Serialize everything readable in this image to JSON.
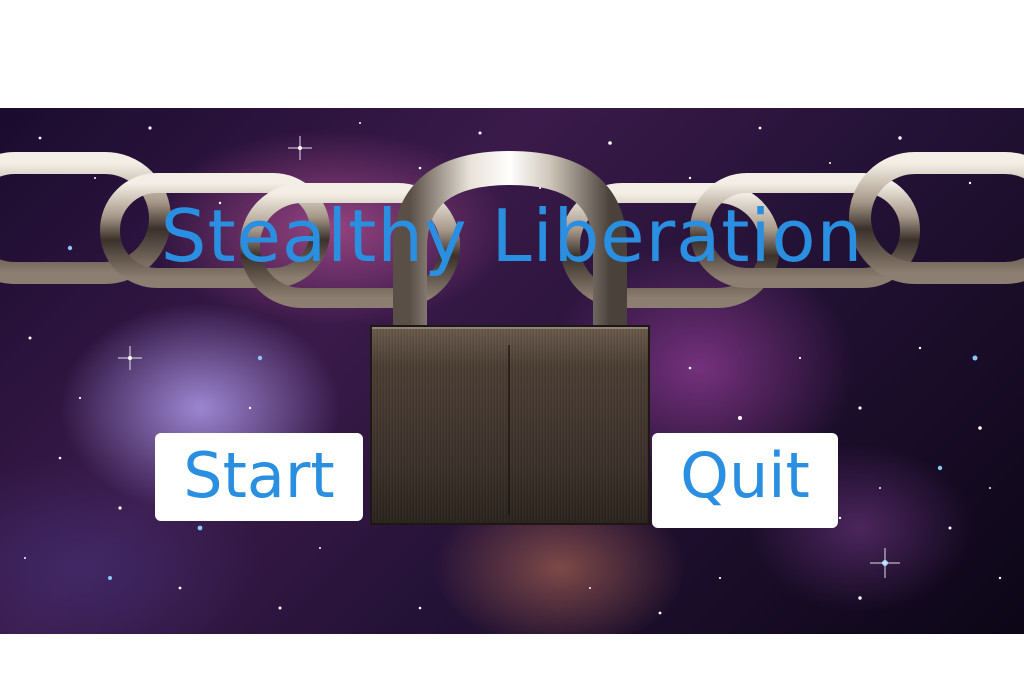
{
  "game": {
    "title": "Stealthy Liberation"
  },
  "menu": {
    "start_label": "Start",
    "quit_label": "Quit"
  },
  "colors": {
    "title_text": "#2a8fe0",
    "button_background": "#ffffff",
    "page_background": "#ffffff"
  },
  "icons": {
    "chain": "chain-icon",
    "padlock": "padlock-icon"
  }
}
